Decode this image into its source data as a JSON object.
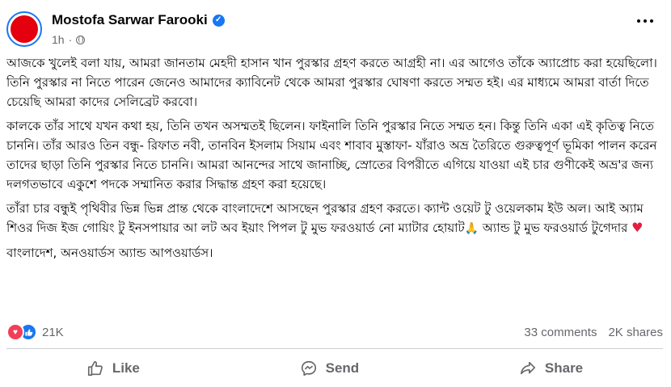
{
  "author": {
    "name": "Mostofa Sarwar Farooki",
    "time": "1h"
  },
  "post": {
    "p1": "আজকে খুলেই বলা যায়, আমরা জানতাম মেহদী হাসান খান পুরস্কার গ্রহণ করতে আগ্রহী না। এর আগেও তাঁকে অ্যাপ্রোচ করা হয়েছিলো। তিনি পুরস্কার না নিতে পারেন জেনেও আমাদের ক্যাবিনেট থেকে আমরা পুরস্কার ঘোষণা করতে সম্মত হই। এর মাধ্যমে আমরা বার্তা দিতে চেয়েছি আমরা কাদের সেলিব্রেট করবো।",
    "p2": "কালকে তাঁর সাথে যখন কথা হয়, তিনি তখন অসম্মতই ছিলেন। ফাইনালি তিনি পুরস্কার নিতে সম্মত হন। কিন্তু তিনি একা এই কৃতিত্ব নিতে চাননি। তাঁর আরও তিন বন্ধু- রিফাত নবী, তানবিন ইসলাম সিয়াম এবং শাবাব মুস্তাফা- যাঁরাও অভ্র তৈরিতে গুরুত্বপূর্ণ ভূমিকা পালন করেন তাদের ছাড়া তিনি পুরস্কার নিতে চাননি। আমরা আনন্দের সাথে জানাচ্ছি, স্রোতের বিপরীতে এগিয়ে যাওয়া এই চার গুণীকেই অভ্র'র জন্য দলগতভাবে একুশে পদকে সম্মানিত করার সিদ্ধান্ত গ্রহণ করা হয়েছে।",
    "p3": "তাঁরা চার বন্ধুই পৃথিবীর ভিন্ন ভিন্ন প্রান্ত থেকে বাংলাদেশে আসছেন পুরস্কার গ্রহণ করতে। ক্যান্ট ওয়েট টু ওয়েলকাম ইউ অল। আই অ্যাম শিওর দিজ ইজ গোয়িং টু ইনসপায়ার আ লট অব ইয়াং পিপল টু মুভ ফরওয়ার্ড নো ম্যাটার হোয়াট",
    "p3b": " অ্যান্ড টু মুভ ফরওয়ার্ড টুগেদার ",
    "p4": "বাংলাদেশ, অনওয়ার্ডস অ্যান্ড আপওয়ার্ডস।"
  },
  "stats": {
    "reactions": "21K",
    "comments": "33 comments",
    "shares": "2K shares"
  },
  "actions": {
    "like": "Like",
    "send": "Send",
    "share": "Share"
  },
  "colors": {
    "accent": "#1877f2",
    "love": "#f33e58",
    "avatar": "#e4000f",
    "muted": "#65676b"
  },
  "icons": [
    "verified-badge-icon",
    "globe-icon",
    "more-options-icon",
    "love-reaction-icon",
    "like-reaction-icon",
    "like-icon",
    "send-icon",
    "share-icon",
    "pray-emoji",
    "heart-emoji"
  ]
}
